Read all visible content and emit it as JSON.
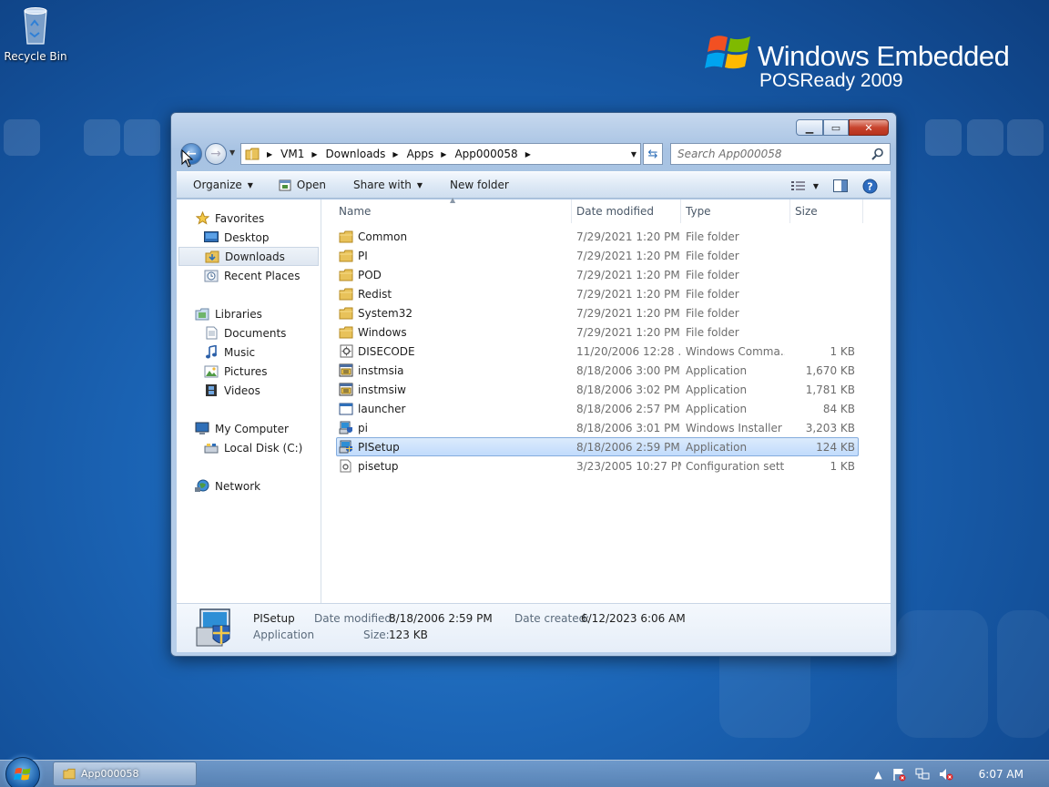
{
  "desktop": {
    "recycle_bin_label": "Recycle Bin",
    "brand_line1": "Windows Embedded",
    "brand_line2": "POSReady 2009"
  },
  "window": {
    "address": {
      "crumbs": [
        "VM1",
        "Downloads",
        "Apps",
        "App000058"
      ]
    },
    "search": {
      "placeholder": "Search App000058"
    },
    "toolbar": {
      "organize": "Organize",
      "open": "Open",
      "share_with": "Share with",
      "new_folder": "New folder"
    },
    "nav": {
      "favorites": "Favorites",
      "desktop": "Desktop",
      "downloads": "Downloads",
      "recent_places": "Recent Places",
      "libraries": "Libraries",
      "documents": "Documents",
      "music": "Music",
      "pictures": "Pictures",
      "videos": "Videos",
      "my_computer": "My Computer",
      "local_disk": "Local Disk (C:)",
      "network": "Network"
    },
    "columns": {
      "name": "Name",
      "date_modified": "Date modified",
      "type": "Type",
      "size": "Size"
    },
    "files": [
      {
        "name": "Common",
        "date": "7/29/2021 1:20 PM",
        "type": "File folder",
        "size": "",
        "icon": "folder-icon"
      },
      {
        "name": "PI",
        "date": "7/29/2021 1:20 PM",
        "type": "File folder",
        "size": "",
        "icon": "folder-icon"
      },
      {
        "name": "POD",
        "date": "7/29/2021 1:20 PM",
        "type": "File folder",
        "size": "",
        "icon": "folder-icon"
      },
      {
        "name": "Redist",
        "date": "7/29/2021 1:20 PM",
        "type": "File folder",
        "size": "",
        "icon": "folder-icon"
      },
      {
        "name": "System32",
        "date": "7/29/2021 1:20 PM",
        "type": "File folder",
        "size": "",
        "icon": "folder-icon"
      },
      {
        "name": "Windows",
        "date": "7/29/2021 1:20 PM",
        "type": "File folder",
        "size": "",
        "icon": "folder-icon"
      },
      {
        "name": "DISECODE",
        "date": "11/20/2006 12:28 ...",
        "type": "Windows Comma...",
        "size": "1 KB",
        "icon": "batch-file-icon"
      },
      {
        "name": "instmsia",
        "date": "8/18/2006 3:00 PM",
        "type": "Application",
        "size": "1,670 KB",
        "icon": "installer-app-icon"
      },
      {
        "name": "instmsiw",
        "date": "8/18/2006 3:02 PM",
        "type": "Application",
        "size": "1,781 KB",
        "icon": "installer-app-icon"
      },
      {
        "name": "launcher",
        "date": "8/18/2006 2:57 PM",
        "type": "Application",
        "size": "84 KB",
        "icon": "application-window-icon"
      },
      {
        "name": "pi",
        "date": "8/18/2006 3:01 PM",
        "type": "Windows Installer ...",
        "size": "3,203 KB",
        "icon": "msi-package-icon"
      },
      {
        "name": "PISetup",
        "date": "8/18/2006 2:59 PM",
        "type": "Application",
        "size": "124 KB",
        "icon": "setup-app-icon",
        "selected": true
      },
      {
        "name": "pisetup",
        "date": "3/23/2005 10:27 PM",
        "type": "Configuration sett...",
        "size": "1 KB",
        "icon": "config-file-icon"
      }
    ],
    "details": {
      "name": "PISetup",
      "kind": "Application",
      "date_modified_label": "Date modified:",
      "date_modified": "8/18/2006 2:59 PM",
      "size_label": "Size:",
      "size": "123 KB",
      "date_created_label": "Date created:",
      "date_created": "6/12/2023 6:06 AM"
    }
  },
  "taskbar": {
    "task_label": "App000058",
    "clock": "6:07 AM"
  },
  "colors": {
    "desktop": "#1b64b5",
    "selection": "#c1dbfc",
    "close_button": "#c8442e"
  }
}
